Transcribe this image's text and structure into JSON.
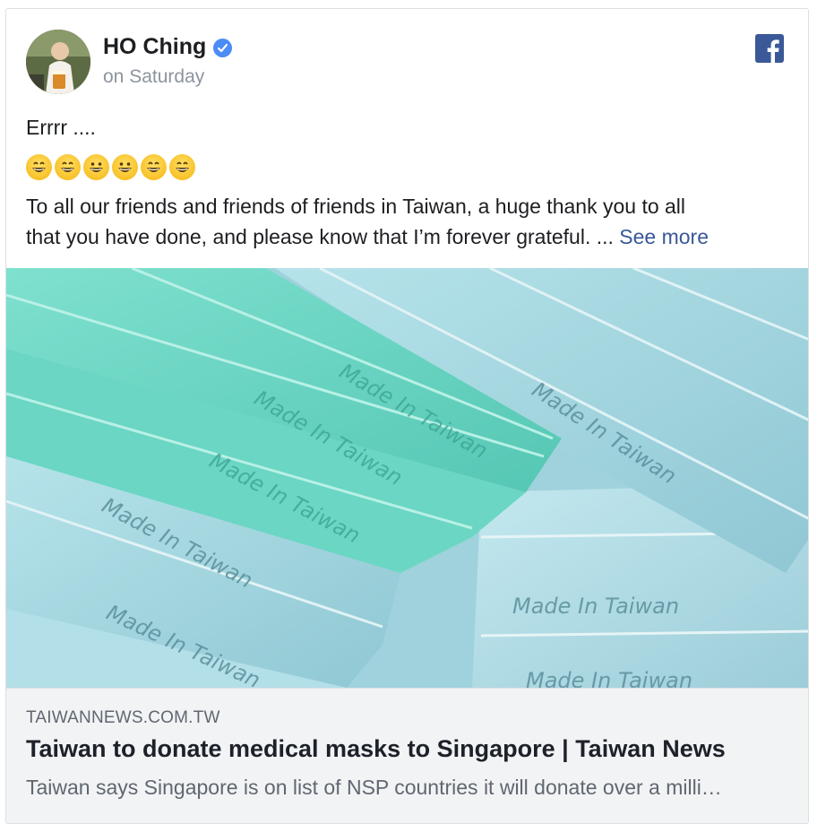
{
  "post": {
    "author_name": "HO Ching",
    "timestamp": "on Saturday",
    "line1": "Errrr ....",
    "emojis": [
      "grinning-face",
      "grinning-face",
      "grinning-face",
      "grinning-face",
      "grinning-face",
      "grinning-face"
    ],
    "body_line1": "To all our friends and friends of friends in Taiwan, a huge thank you to all",
    "body_line2": "that you have done, and please know that I’m forever grateful. ...",
    "see_more": "See more"
  },
  "photo": {
    "mask_texts": [
      "Made In Taiwan",
      "Made In Taiwan",
      "Made In Taiwan",
      "Made In Taiwan",
      "Made In Taiwan",
      "Made In Taiwan",
      "Made In Taiwan",
      "Made In Taiwan"
    ]
  },
  "link": {
    "domain": "TAIWANNEWS.COM.TW",
    "title": "Taiwan to donate medical masks to Singapore | Taiwan News",
    "description": "Taiwan says Singapore is on list of NSP countries it will donate over a milli…"
  },
  "colors": {
    "verified": "#4b8cf5",
    "facebook_brand": "#3b5998",
    "link": "#385898"
  },
  "icons": [
    "verified-badge-icon",
    "facebook-icon"
  ]
}
